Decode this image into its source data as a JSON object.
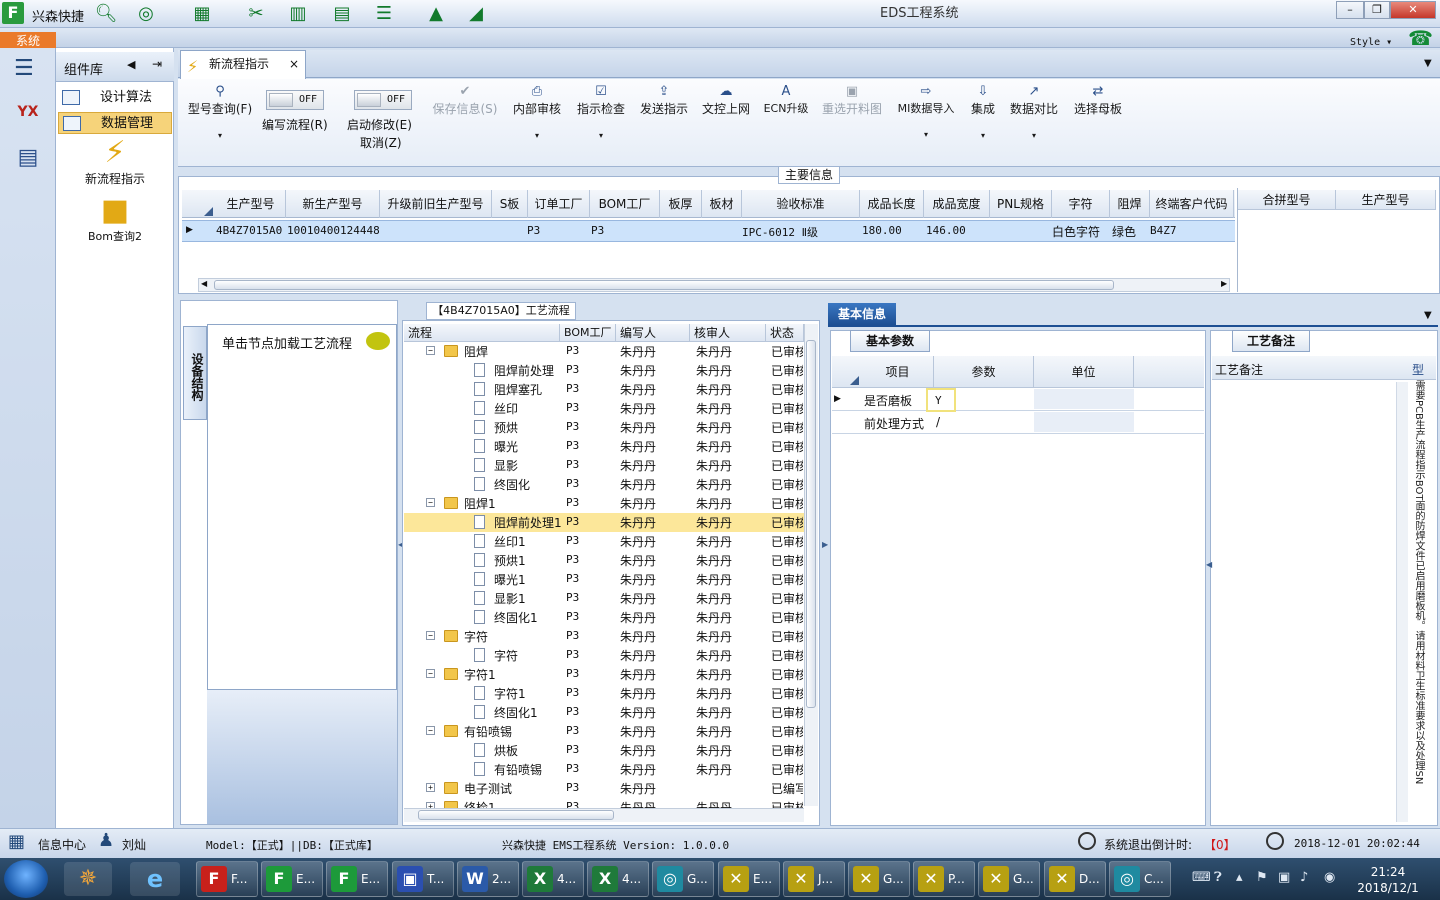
{
  "app": {
    "name": "兴森快捷",
    "window_title": "EDS工程系统",
    "menu_system": "系统",
    "style_label": "Style",
    "logo_letter": "F"
  },
  "colors": {
    "accent": "#1d4f93",
    "brand_green": "#2a9b3e",
    "selection": "#cde3fb",
    "tree_selection": "#fce79a",
    "warn_red": "#d01818"
  },
  "component_panel": {
    "title": "组件库",
    "items": [
      {
        "label": "设计算法"
      },
      {
        "label": "数据管理"
      }
    ],
    "big_items": [
      {
        "label": "新流程指示",
        "icon": "lightning-icon"
      },
      {
        "label": "Bom查询2",
        "icon": "folder-open-icon"
      }
    ]
  },
  "tab": {
    "label": "新流程指示",
    "close": "×"
  },
  "toolbar": {
    "model_query": "型号查询(F)",
    "edit_flow_toggle": "OFF",
    "edit_flow": "编写流程(R)",
    "start_modify_toggle": "OFF",
    "start_modify": "启动修改(E)",
    "cancel": "取消(Z)",
    "save_info": "保存信息(S)",
    "internal_review": "内部审核",
    "instruction_check": "指示检查",
    "send_instruction": "发送指示",
    "doc_upload": "文控上网",
    "ecn_upgrade": "ECN升级",
    "reselect_chart": "重选开料图",
    "mi_import": "MI数据导入",
    "integrate": "集成",
    "data_compare": "数据对比",
    "select_mother": "选择母板"
  },
  "main_info": {
    "title": "主要信息",
    "columns": [
      "生产型号",
      "新生产型号",
      "升级前旧生产型号",
      "S板",
      "订单工厂",
      "BOM工厂",
      "板厚",
      "板材",
      "验收标准",
      "成品长度",
      "成品宽度",
      "PNL规格",
      "字符",
      "阻焊",
      "终端客户代码"
    ],
    "row": {
      "prod_model": "4B4Z7015A0",
      "new_model": "10010400124448",
      "old_model": "",
      "s_board": "",
      "order_factory": "P3",
      "bom_factory": "P3",
      "thickness": "",
      "material": "",
      "standard": "IPC-6012 Ⅱ级",
      "length": "180.00",
      "width": "146.00",
      "pnl_spec": "",
      "character": "白色字符",
      "solder_mask": "绿色",
      "customer_code": "B4Z7"
    },
    "side_columns": [
      "合拼型号",
      "生产型号"
    ]
  },
  "device_panel": {
    "tab": "设备结构",
    "hint": "单击节点加载工艺流程"
  },
  "flow": {
    "title": "【4B4Z7015A0】工艺流程",
    "columns": [
      "流程",
      "BOM工厂",
      "编写人",
      "核审人",
      "状态"
    ],
    "rows": [
      {
        "name": "阻焊",
        "level": 0,
        "folder": true,
        "bom": "P3",
        "writer": "朱丹丹",
        "reviewer": "朱丹丹",
        "status": "已审核"
      },
      {
        "name": "阻焊前处理",
        "level": 1,
        "folder": false,
        "bom": "P3",
        "writer": "朱丹丹",
        "reviewer": "朱丹丹",
        "status": "已审核"
      },
      {
        "name": "阻焊塞孔",
        "level": 1,
        "folder": false,
        "bom": "P3",
        "writer": "朱丹丹",
        "reviewer": "朱丹丹",
        "status": "已审核"
      },
      {
        "name": "丝印",
        "level": 1,
        "folder": false,
        "bom": "P3",
        "writer": "朱丹丹",
        "reviewer": "朱丹丹",
        "status": "已审核"
      },
      {
        "name": "预烘",
        "level": 1,
        "folder": false,
        "bom": "P3",
        "writer": "朱丹丹",
        "reviewer": "朱丹丹",
        "status": "已审核"
      },
      {
        "name": "曝光",
        "level": 1,
        "folder": false,
        "bom": "P3",
        "writer": "朱丹丹",
        "reviewer": "朱丹丹",
        "status": "已审核"
      },
      {
        "name": "显影",
        "level": 1,
        "folder": false,
        "bom": "P3",
        "writer": "朱丹丹",
        "reviewer": "朱丹丹",
        "status": "已审核"
      },
      {
        "name": "终固化",
        "level": 1,
        "folder": false,
        "bom": "P3",
        "writer": "朱丹丹",
        "reviewer": "朱丹丹",
        "status": "已审核"
      },
      {
        "name": "阻焊1",
        "level": 0,
        "folder": true,
        "bom": "P3",
        "writer": "朱丹丹",
        "reviewer": "朱丹丹",
        "status": "已审核"
      },
      {
        "name": "阻焊前处理1",
        "level": 1,
        "folder": false,
        "bom": "P3",
        "writer": "朱丹丹",
        "reviewer": "朱丹丹",
        "status": "已审核",
        "selected": true
      },
      {
        "name": "丝印1",
        "level": 1,
        "folder": false,
        "bom": "P3",
        "writer": "朱丹丹",
        "reviewer": "朱丹丹",
        "status": "已审核"
      },
      {
        "name": "预烘1",
        "level": 1,
        "folder": false,
        "bom": "P3",
        "writer": "朱丹丹",
        "reviewer": "朱丹丹",
        "status": "已审核"
      },
      {
        "name": "曝光1",
        "level": 1,
        "folder": false,
        "bom": "P3",
        "writer": "朱丹丹",
        "reviewer": "朱丹丹",
        "status": "已审核"
      },
      {
        "name": "显影1",
        "level": 1,
        "folder": false,
        "bom": "P3",
        "writer": "朱丹丹",
        "reviewer": "朱丹丹",
        "status": "已审核"
      },
      {
        "name": "终固化1",
        "level": 1,
        "folder": false,
        "bom": "P3",
        "writer": "朱丹丹",
        "reviewer": "朱丹丹",
        "status": "已审核"
      },
      {
        "name": "字符",
        "level": 0,
        "folder": true,
        "bom": "P3",
        "writer": "朱丹丹",
        "reviewer": "朱丹丹",
        "status": "已审核"
      },
      {
        "name": "字符",
        "level": 1,
        "folder": false,
        "bom": "P3",
        "writer": "朱丹丹",
        "reviewer": "朱丹丹",
        "status": "已审核"
      },
      {
        "name": "字符1",
        "level": 0,
        "folder": true,
        "bom": "P3",
        "writer": "朱丹丹",
        "reviewer": "朱丹丹",
        "status": "已审核"
      },
      {
        "name": "字符1",
        "level": 1,
        "folder": false,
        "bom": "P3",
        "writer": "朱丹丹",
        "reviewer": "朱丹丹",
        "status": "已审核"
      },
      {
        "name": "终固化1",
        "level": 1,
        "folder": false,
        "bom": "P3",
        "writer": "朱丹丹",
        "reviewer": "朱丹丹",
        "status": "已审核"
      },
      {
        "name": "有铅喷锡",
        "level": 0,
        "folder": true,
        "bom": "P3",
        "writer": "朱丹丹",
        "reviewer": "朱丹丹",
        "status": "已审核"
      },
      {
        "name": "烘板",
        "level": 1,
        "folder": false,
        "bom": "P3",
        "writer": "朱丹丹",
        "reviewer": "朱丹丹",
        "status": "已审核"
      },
      {
        "name": "有铅喷锡",
        "level": 1,
        "folder": false,
        "bom": "P3",
        "writer": "朱丹丹",
        "reviewer": "朱丹丹",
        "status": "已审核"
      },
      {
        "name": "电子测试",
        "level": 0,
        "folder": true,
        "bom": "P3",
        "writer": "朱丹丹",
        "reviewer": "",
        "status": "已编写"
      },
      {
        "name": "终检1",
        "level": 0,
        "folder": true,
        "bom": "P3",
        "writer": "朱丹丹",
        "reviewer": "朱丹丹",
        "status": "已审核"
      }
    ]
  },
  "basic_info": {
    "tab": "基本信息",
    "params_tab": "基本参数",
    "columns": [
      "项目",
      "参数",
      "单位"
    ],
    "rows": [
      {
        "item": "是否磨板",
        "param": "Y",
        "unit": ""
      },
      {
        "item": "前处理方式",
        "param": "/",
        "unit": ""
      }
    ],
    "notes_tab": "工艺备注",
    "notes_header": "工艺备注",
    "notes_type_header": "型",
    "notes_vertical": "需要PCB生产流程指示BOT面的防焊文件已启用磨板机。请用材料卫生标准要求以及处理SN"
  },
  "status": {
    "info_center": "信息中心",
    "user": "刘灿",
    "model_db": "Model:【正式】||DB:【正式库】",
    "system_version": "兴森快捷 EMS工程系统 Version: 1.0.0.0",
    "countdown_label": "系统退出倒计时:",
    "countdown_value": "【0】",
    "datetime": "2018-12-01 20:02:44"
  },
  "taskbar": {
    "time": "21:24",
    "date": "2018/12/1",
    "tasks": [
      {
        "label": "F...",
        "icon": "F",
        "color": "#c8211b"
      },
      {
        "label": "E...",
        "icon": "F",
        "color": "#1d9a3a"
      },
      {
        "label": "E...",
        "icon": "F",
        "color": "#1d9a3a"
      },
      {
        "label": "T...",
        "icon": "▣",
        "color": "#2b4fb0"
      },
      {
        "label": "2...",
        "icon": "W",
        "color": "#2b5aa8"
      },
      {
        "label": "4...",
        "icon": "X",
        "color": "#1f7a3a"
      },
      {
        "label": "4...",
        "icon": "X",
        "color": "#1f7a3a"
      },
      {
        "label": "G...",
        "icon": "◎",
        "color": "#1f8aa0"
      },
      {
        "label": "E...",
        "icon": "✕",
        "color": "#b7a012"
      },
      {
        "label": "J...",
        "icon": "✕",
        "color": "#b7a012"
      },
      {
        "label": "G...",
        "icon": "✕",
        "color": "#b7a012"
      },
      {
        "label": "P...",
        "icon": "✕",
        "color": "#b7a012"
      },
      {
        "label": "G...",
        "icon": "✕",
        "color": "#b7a012"
      },
      {
        "label": "D...",
        "icon": "✕",
        "color": "#b7a012"
      },
      {
        "label": "C...",
        "icon": "◎",
        "color": "#1f8aa0"
      }
    ]
  }
}
